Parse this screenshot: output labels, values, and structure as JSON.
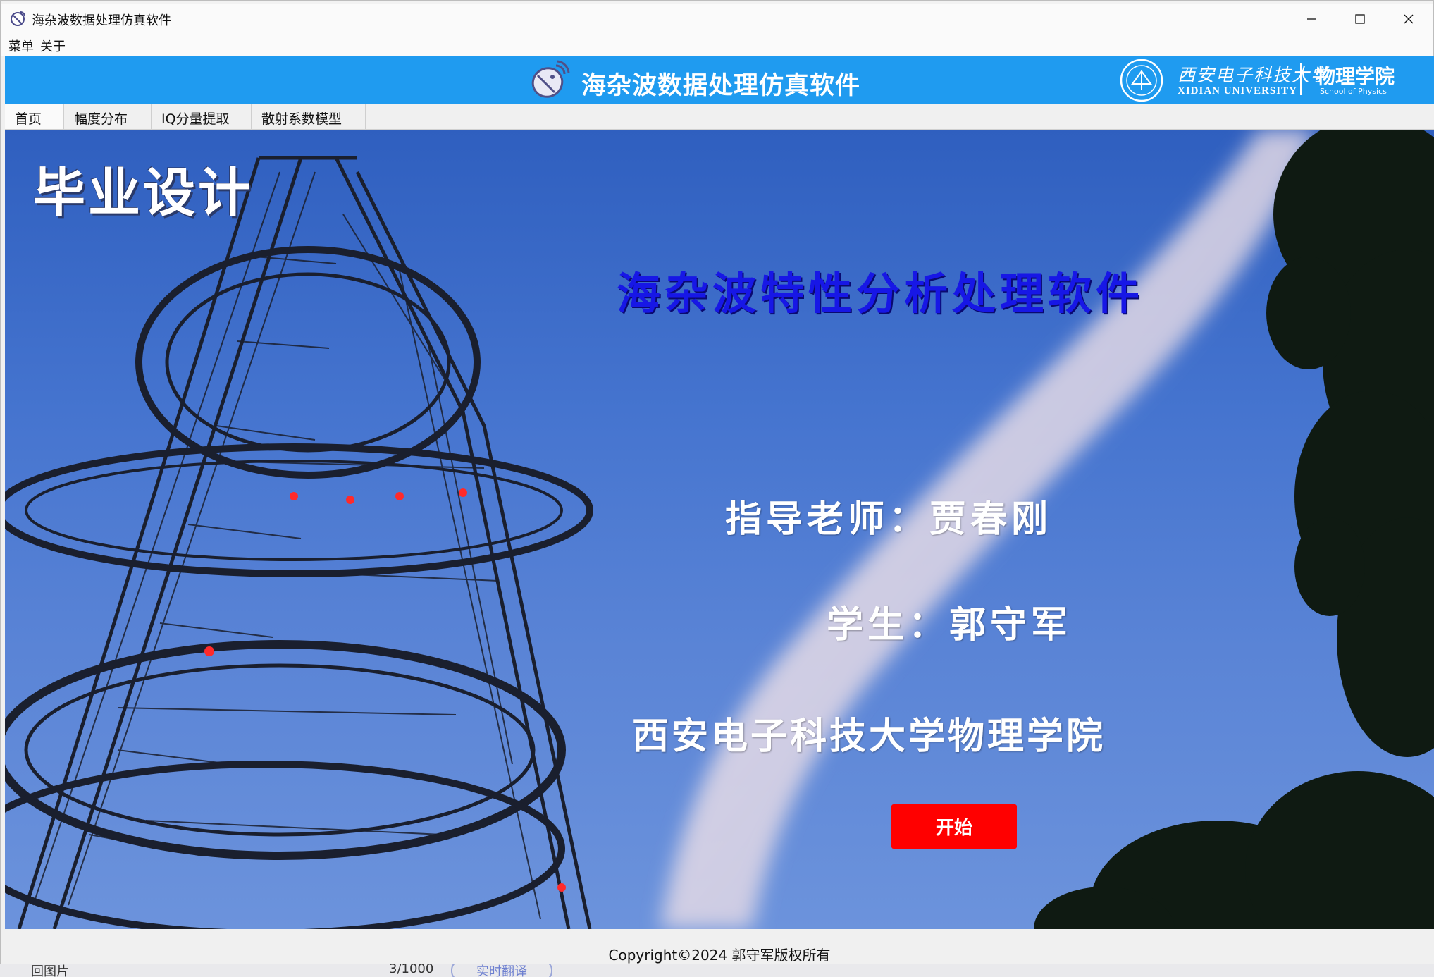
{
  "window": {
    "title": "海杂波数据处理仿真软件",
    "controls": {
      "minimize": "—",
      "maximize": "☐",
      "close": "✕"
    }
  },
  "menubar": {
    "items": [
      "菜单",
      "关于"
    ]
  },
  "banner": {
    "title": "海杂波数据处理仿真软件",
    "university_cn": "西安电子科技大学",
    "university_en": "XIDIAN UNIVERSITY",
    "college_cn": "物理学院",
    "college_en": "School of Physics"
  },
  "tabs": [
    {
      "label": "首页",
      "active": true
    },
    {
      "label": "幅度分布",
      "active": false
    },
    {
      "label": "IQ分量提取",
      "active": false
    },
    {
      "label": "散射系数模型",
      "active": false
    }
  ],
  "hero": {
    "corner_label": "毕业设计",
    "software_title": "海杂波特性分析处理软件",
    "advisor": "指导老师：贾春刚",
    "student": "学生：郭守军",
    "school": "西安电子科技大学物理学院",
    "start_button": "开始"
  },
  "footer": {
    "copyright": "Copyright©2024 郭守军版权所有"
  },
  "background_strip": {
    "text1": "回图片",
    "text2": "3/1000",
    "text3": "实时翻译"
  },
  "colors": {
    "banner": "#1f9bf0",
    "start_button": "#ff0000",
    "software_title": "#1717e6"
  },
  "icons": [
    "satellite-dish-icon",
    "minimize-icon",
    "maximize-icon",
    "close-icon",
    "university-seal-icon"
  ]
}
